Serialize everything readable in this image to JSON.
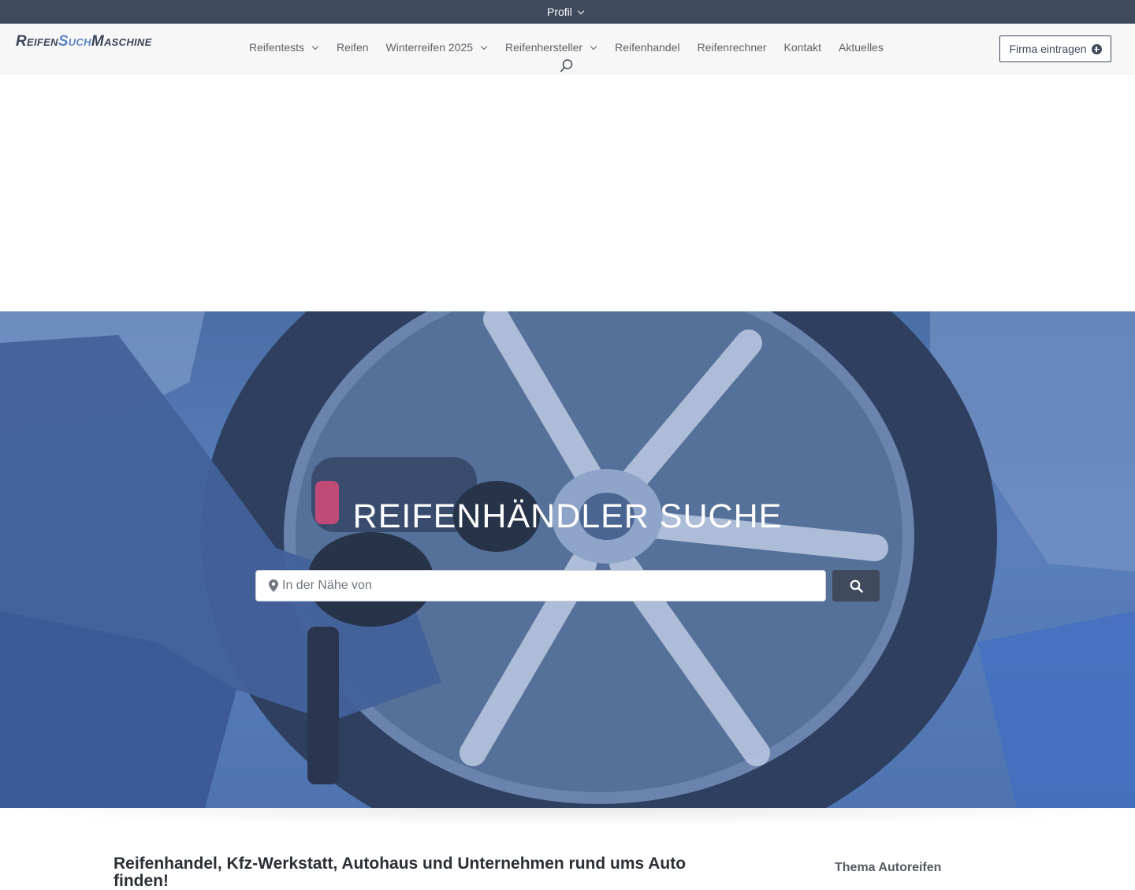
{
  "topbar": {
    "profil_label": "Profil"
  },
  "logo": {
    "part1": "Reifen",
    "part2": "Such",
    "part3": "Maschine"
  },
  "nav": {
    "items": [
      {
        "label": "Reifentests",
        "dropdown": true
      },
      {
        "label": "Reifen",
        "dropdown": false
      },
      {
        "label": "Winterreifen 2025",
        "dropdown": true
      },
      {
        "label": "Reifenhersteller",
        "dropdown": true
      },
      {
        "label": "Reifenhandel",
        "dropdown": false
      },
      {
        "label": "Reifenrechner",
        "dropdown": false
      },
      {
        "label": "Kontakt",
        "dropdown": false
      },
      {
        "label": "Aktuelles",
        "dropdown": false
      }
    ]
  },
  "header": {
    "cta_label": "Firma eintragen"
  },
  "hero": {
    "title": "REIFENHÄNDLER SUCHE",
    "search_placeholder": "In der Nähe von"
  },
  "content": {
    "title": "Reifenhandel, Kfz-Werkstatt, Autohaus und Unternehmen rund ums Auto finden!",
    "sidebar_title": "Thema Autoreifen"
  },
  "colors": {
    "primary": "#3f4a5c",
    "accent": "#5b86c4",
    "hero_overlay": "#5a7fbb"
  }
}
